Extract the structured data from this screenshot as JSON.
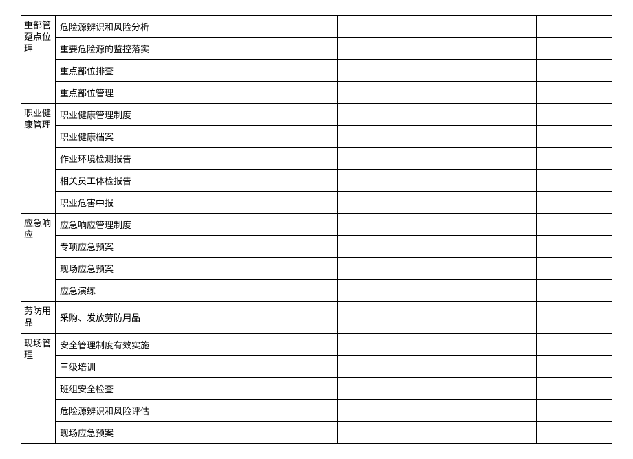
{
  "groups": [
    {
      "label": "重部管趸点位理",
      "items": [
        "危险源辨识和风险分析",
        "重要危险源的监控落实",
        "重点部位排查",
        "重点部位管理"
      ]
    },
    {
      "label": "职业健康管理",
      "items": [
        "职业健康管理制度",
        "职业健康档案",
        "作业环境检测报告",
        "相关员工体检报告",
        "职业危害中报"
      ]
    },
    {
      "label": "应急响应",
      "items": [
        "应急响应管理制度",
        "专项应急预案",
        "现场应急预案",
        "应急演练"
      ]
    },
    {
      "label": "劳防用品",
      "items": [
        "采购、发放劳防用品"
      ]
    },
    {
      "label": "现场管理",
      "items": [
        "安全管理制度有效实施",
        "三级培训",
        "班组安全检查",
        "危险源辨识和风险评估",
        "现场应急预案"
      ]
    }
  ]
}
